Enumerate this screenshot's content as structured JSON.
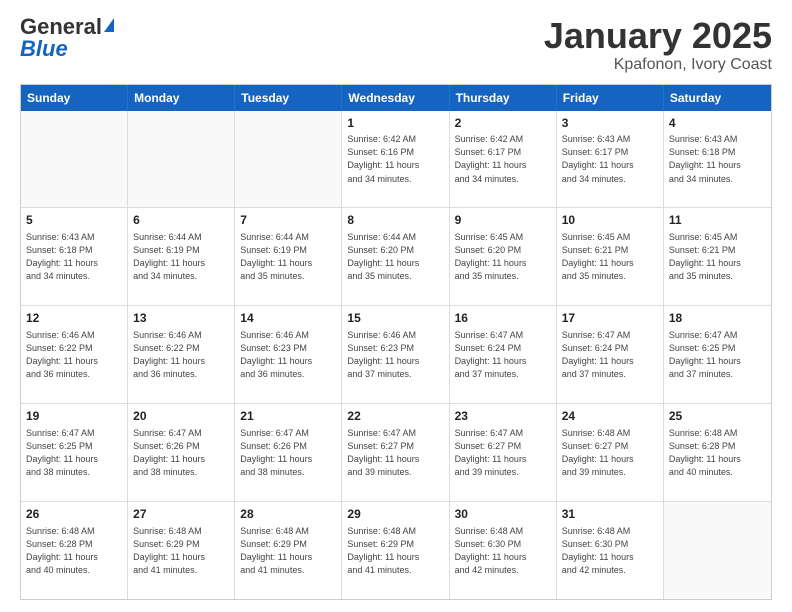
{
  "logo": {
    "general": "General",
    "blue": "Blue"
  },
  "title": "January 2025",
  "subtitle": "Kpafonon, Ivory Coast",
  "header_days": [
    "Sunday",
    "Monday",
    "Tuesday",
    "Wednesday",
    "Thursday",
    "Friday",
    "Saturday"
  ],
  "weeks": [
    [
      {
        "day": "",
        "info": ""
      },
      {
        "day": "",
        "info": ""
      },
      {
        "day": "",
        "info": ""
      },
      {
        "day": "1",
        "info": "Sunrise: 6:42 AM\nSunset: 6:16 PM\nDaylight: 11 hours\nand 34 minutes."
      },
      {
        "day": "2",
        "info": "Sunrise: 6:42 AM\nSunset: 6:17 PM\nDaylight: 11 hours\nand 34 minutes."
      },
      {
        "day": "3",
        "info": "Sunrise: 6:43 AM\nSunset: 6:17 PM\nDaylight: 11 hours\nand 34 minutes."
      },
      {
        "day": "4",
        "info": "Sunrise: 6:43 AM\nSunset: 6:18 PM\nDaylight: 11 hours\nand 34 minutes."
      }
    ],
    [
      {
        "day": "5",
        "info": "Sunrise: 6:43 AM\nSunset: 6:18 PM\nDaylight: 11 hours\nand 34 minutes."
      },
      {
        "day": "6",
        "info": "Sunrise: 6:44 AM\nSunset: 6:19 PM\nDaylight: 11 hours\nand 34 minutes."
      },
      {
        "day": "7",
        "info": "Sunrise: 6:44 AM\nSunset: 6:19 PM\nDaylight: 11 hours\nand 35 minutes."
      },
      {
        "day": "8",
        "info": "Sunrise: 6:44 AM\nSunset: 6:20 PM\nDaylight: 11 hours\nand 35 minutes."
      },
      {
        "day": "9",
        "info": "Sunrise: 6:45 AM\nSunset: 6:20 PM\nDaylight: 11 hours\nand 35 minutes."
      },
      {
        "day": "10",
        "info": "Sunrise: 6:45 AM\nSunset: 6:21 PM\nDaylight: 11 hours\nand 35 minutes."
      },
      {
        "day": "11",
        "info": "Sunrise: 6:45 AM\nSunset: 6:21 PM\nDaylight: 11 hours\nand 35 minutes."
      }
    ],
    [
      {
        "day": "12",
        "info": "Sunrise: 6:46 AM\nSunset: 6:22 PM\nDaylight: 11 hours\nand 36 minutes."
      },
      {
        "day": "13",
        "info": "Sunrise: 6:46 AM\nSunset: 6:22 PM\nDaylight: 11 hours\nand 36 minutes."
      },
      {
        "day": "14",
        "info": "Sunrise: 6:46 AM\nSunset: 6:23 PM\nDaylight: 11 hours\nand 36 minutes."
      },
      {
        "day": "15",
        "info": "Sunrise: 6:46 AM\nSunset: 6:23 PM\nDaylight: 11 hours\nand 37 minutes."
      },
      {
        "day": "16",
        "info": "Sunrise: 6:47 AM\nSunset: 6:24 PM\nDaylight: 11 hours\nand 37 minutes."
      },
      {
        "day": "17",
        "info": "Sunrise: 6:47 AM\nSunset: 6:24 PM\nDaylight: 11 hours\nand 37 minutes."
      },
      {
        "day": "18",
        "info": "Sunrise: 6:47 AM\nSunset: 6:25 PM\nDaylight: 11 hours\nand 37 minutes."
      }
    ],
    [
      {
        "day": "19",
        "info": "Sunrise: 6:47 AM\nSunset: 6:25 PM\nDaylight: 11 hours\nand 38 minutes."
      },
      {
        "day": "20",
        "info": "Sunrise: 6:47 AM\nSunset: 6:26 PM\nDaylight: 11 hours\nand 38 minutes."
      },
      {
        "day": "21",
        "info": "Sunrise: 6:47 AM\nSunset: 6:26 PM\nDaylight: 11 hours\nand 38 minutes."
      },
      {
        "day": "22",
        "info": "Sunrise: 6:47 AM\nSunset: 6:27 PM\nDaylight: 11 hours\nand 39 minutes."
      },
      {
        "day": "23",
        "info": "Sunrise: 6:47 AM\nSunset: 6:27 PM\nDaylight: 11 hours\nand 39 minutes."
      },
      {
        "day": "24",
        "info": "Sunrise: 6:48 AM\nSunset: 6:27 PM\nDaylight: 11 hours\nand 39 minutes."
      },
      {
        "day": "25",
        "info": "Sunrise: 6:48 AM\nSunset: 6:28 PM\nDaylight: 11 hours\nand 40 minutes."
      }
    ],
    [
      {
        "day": "26",
        "info": "Sunrise: 6:48 AM\nSunset: 6:28 PM\nDaylight: 11 hours\nand 40 minutes."
      },
      {
        "day": "27",
        "info": "Sunrise: 6:48 AM\nSunset: 6:29 PM\nDaylight: 11 hours\nand 41 minutes."
      },
      {
        "day": "28",
        "info": "Sunrise: 6:48 AM\nSunset: 6:29 PM\nDaylight: 11 hours\nand 41 minutes."
      },
      {
        "day": "29",
        "info": "Sunrise: 6:48 AM\nSunset: 6:29 PM\nDaylight: 11 hours\nand 41 minutes."
      },
      {
        "day": "30",
        "info": "Sunrise: 6:48 AM\nSunset: 6:30 PM\nDaylight: 11 hours\nand 42 minutes."
      },
      {
        "day": "31",
        "info": "Sunrise: 6:48 AM\nSunset: 6:30 PM\nDaylight: 11 hours\nand 42 minutes."
      },
      {
        "day": "",
        "info": ""
      }
    ]
  ]
}
